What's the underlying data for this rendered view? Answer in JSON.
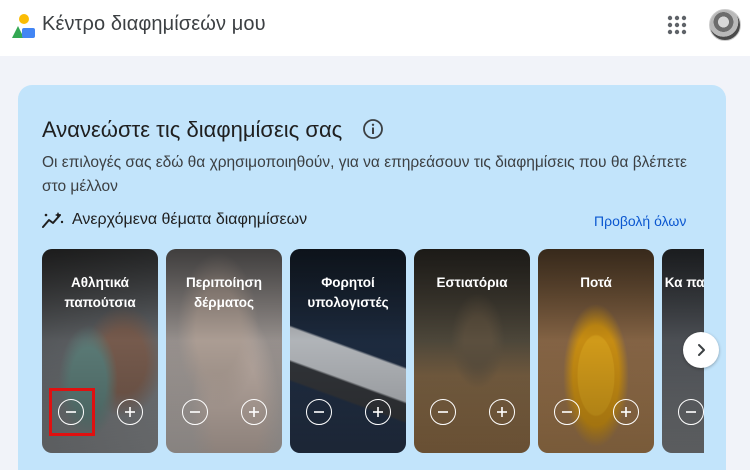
{
  "header": {
    "app_title": "Κέντρο διαφημίσεών μου",
    "apps_icon": "apps-grid-icon",
    "avatar_icon": "user-avatar"
  },
  "card": {
    "title": "Ανανεώστε τις διαφημίσεις σας",
    "description": "Οι επιλογές σας εδώ θα χρησιμοποιηθούν, για να επηρεάσουν τις διαφημίσεις που θα βλέπετε στο μέλλον",
    "section_title": "Ανερχόμενα θέματα διαφημίσεων",
    "view_all": "Προβολή όλων",
    "background": "#c2e4fb",
    "link_color": "#0b57d0"
  },
  "tiles": [
    {
      "label": "Αθλητικά παπούτσια"
    },
    {
      "label": "Περιποίηση δέρματος"
    },
    {
      "label": "Φορητοί υπολογιστές"
    },
    {
      "label": "Εστιατόρια"
    },
    {
      "label": "Ποτά"
    },
    {
      "label": "Κα παν"
    }
  ],
  "icons": {
    "minus": "minus-circle-icon",
    "plus": "plus-circle-icon",
    "next": "chevron-right-icon"
  }
}
